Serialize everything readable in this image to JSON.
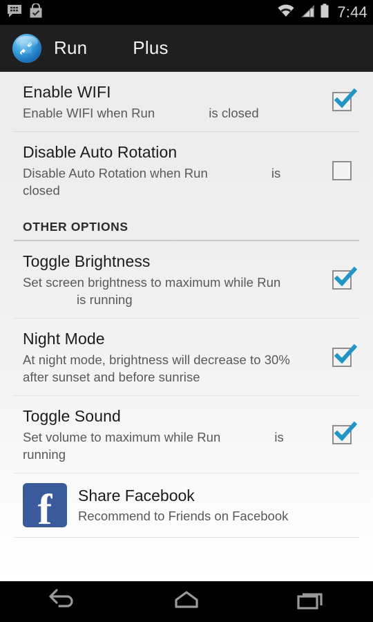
{
  "status_bar": {
    "icons": [
      "bbm-messenger-icon",
      "play-store-icon"
    ],
    "wifi_icon": "wifi-icon",
    "signal_icon": "cellular-signal-icon",
    "battery_icon": "battery-icon",
    "time": "7:44"
  },
  "action_bar": {
    "app_icon": "app-tools-icon",
    "title": "Run",
    "title_secondary": "Plus"
  },
  "preferences": [
    {
      "name": "enable-wifi",
      "title": "Enable WIFI",
      "summary_before": "Enable WIFI when Run",
      "summary_after": "is closed",
      "checked": true
    },
    {
      "name": "disable-auto-rotation",
      "title": "Disable Auto Rotation",
      "summary_before": "Disable Auto Rotation when Run",
      "summary_after": "is closed",
      "checked": false
    }
  ],
  "section": {
    "header": "OTHER OPTIONS",
    "items": [
      {
        "name": "toggle-brightness",
        "title": "Toggle Brightness",
        "summary_before": "Set screen brightness to maximum while Run",
        "summary_after": "is running",
        "checked": true
      },
      {
        "name": "night-mode",
        "title": "Night Mode",
        "summary_before": "At night mode, brightness will decrease to 30% after sunset and before sunrise",
        "summary_after": "",
        "checked": true
      },
      {
        "name": "toggle-sound",
        "title": "Toggle Sound",
        "summary_before": "Set volume to maximum while Run",
        "summary_after": "is running",
        "checked": true
      }
    ]
  },
  "share": {
    "icon": "facebook-icon",
    "glyph": "f",
    "title": "Share Facebook",
    "summary": "Recommend to Friends on Facebook"
  },
  "nav_bar": {
    "back": "back-icon",
    "home": "home-icon",
    "recents": "recent-apps-icon"
  },
  "colors": {
    "accent_check": "#2196c4",
    "facebook_blue": "#3b5a9b",
    "action_bar_bg": "#1f1f1f",
    "list_bg_top": "#ececec",
    "title_text": "#1b1b1b",
    "summary_text": "#58595b"
  }
}
